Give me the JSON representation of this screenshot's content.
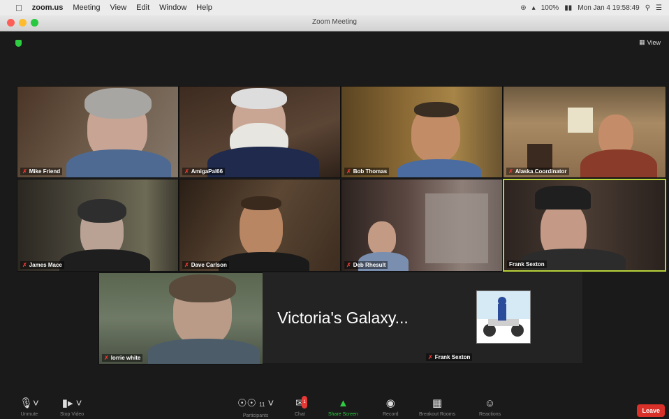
{
  "menubar": {
    "app": "zoom.us",
    "items": [
      "Meeting",
      "View",
      "Edit",
      "Window",
      "Help"
    ],
    "battery": "100%",
    "datetime": "Mon Jan 4  19:58:49"
  },
  "window": {
    "title": "Zoom Meeting"
  },
  "view_button": "View",
  "participants": [
    {
      "name": "Mike Friend"
    },
    {
      "name": "AmigaPal66"
    },
    {
      "name": "Bob Thomas"
    },
    {
      "name": "Alaska Coordinator"
    },
    {
      "name": "James Mace"
    },
    {
      "name": "Dave Carlson"
    },
    {
      "name": "Deb Rhesult"
    },
    {
      "name": "Frank Sexton"
    },
    {
      "name": "lorrie white"
    }
  ],
  "galaxy_label": "Victoria's Galaxy...",
  "avatar_tile_name": "Frank Sexton",
  "toolbar": {
    "unmute": "Unmute",
    "stop_video": "Stop Video",
    "participants": "Participants",
    "participant_count": "11",
    "chat": "Chat",
    "chat_badge": "1",
    "share_screen": "Share Screen",
    "record": "Record",
    "breakout": "Breakout Rooms",
    "reactions": "Reactions",
    "leave": "Leave"
  },
  "colors": {
    "active_speaker": "#b9d33a",
    "leave": "#d9302a",
    "share": "#2ecc40"
  }
}
